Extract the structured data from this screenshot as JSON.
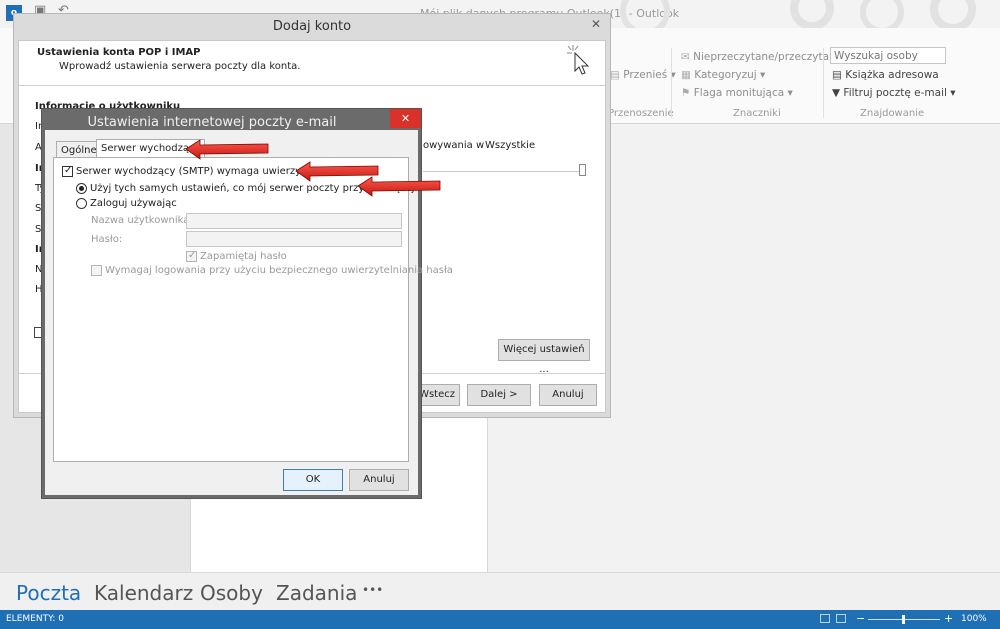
{
  "outlook": {
    "window_title": "Mój plik danych programu Outlook(1) - Outlook",
    "ribbon": {
      "przenies": "Przenieś ▾",
      "przenoszenie": "Przenoszenie",
      "nieprzeczytane": "Nieprzeczytane/przeczytane",
      "kategoryzuj": "Kategoryzuj ▾",
      "flaga": "Flaga monitująca ▾",
      "znaczniki": "Znaczniki",
      "search_placeholder": "Wyszukaj osoby",
      "ksiazka": "Książka adresowa",
      "filtruj": "Filtruj pocztę e-mail ▾",
      "znajdowanie": "Znajdowanie"
    },
    "nav": {
      "poczta": "Poczta",
      "kalendarz": "Kalendarz",
      "osoby": "Osoby",
      "zadania": "Zadania",
      "more": "•••"
    },
    "status": {
      "elements": "ELEMENTY: 0",
      "zoom": "100%"
    },
    "accent_color": "#1f6fb5"
  },
  "dodaj_konto": {
    "title": "Dodaj konto",
    "heading": "Ustawienia konta POP i IMAP",
    "subheading": "Wprowadź ustawienia serwera poczty dla konta.",
    "section_user": "Informacje o użytkowniku",
    "partial_left": [
      "Im",
      "Ad",
      "In",
      "Ty",
      "Se",
      "Se",
      "In",
      "Na",
      "Ha"
    ],
    "offline_label": "owywania w",
    "offline_value": "Wszystkie",
    "more_settings": "Więcej ustawień ...",
    "back": "< Wstecz",
    "next": "Dalej >",
    "cancel": "Anuluj"
  },
  "ustawienia": {
    "title": "Ustawienia internetowej poczty e-mail",
    "tabs": [
      "Ogólne",
      "Serwer wychodzący"
    ],
    "smtp_auth": "Serwer wychodzący (SMTP) wymaga uwierzytelniania",
    "same_settings": "Użyj tych samych ustawień, co mój serwer poczty przychodzącej",
    "login_using": "Zaloguj używając",
    "username_label": "Nazwa użytkownika:",
    "password_label": "Hasło:",
    "remember": "Zapamiętaj hasło",
    "spa": "Wymagaj logowania przy użyciu bezpiecznego uwierzytelniania hasła",
    "ok": "OK",
    "cancel": "Anuluj",
    "close": "✕",
    "close_color": "#d9322a"
  }
}
